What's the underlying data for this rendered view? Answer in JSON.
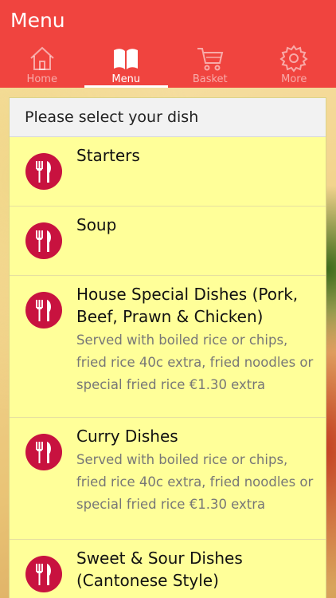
{
  "header": {
    "title": "Menu"
  },
  "tabs": [
    {
      "label": "Home",
      "icon": "home-icon"
    },
    {
      "label": "Menu",
      "icon": "book-icon",
      "active": true
    },
    {
      "label": "Basket",
      "icon": "cart-icon"
    },
    {
      "label": "More",
      "icon": "gear-icon"
    }
  ],
  "colors": {
    "app_bar": "#f0443f",
    "panel_bg": "#ffff99",
    "badge": "#c8123f"
  },
  "panel": {
    "heading": "Please select your dish",
    "items": [
      {
        "title": "Starters",
        "description": ""
      },
      {
        "title": "Soup",
        "description": ""
      },
      {
        "title": "House Special Dishes (Pork, Beef, Prawn & Chicken)",
        "description": "Served with boiled rice or chips, fried rice 40c extra, fried noodles or special fried rice €1.30 extra"
      },
      {
        "title": "Curry Dishes",
        "description": "Served with boiled rice or chips, fried rice 40c extra, fried noodles or special fried rice €1.30 extra"
      },
      {
        "title": "Sweet & Sour Dishes (Cantonese Style)",
        "description": ""
      }
    ]
  }
}
